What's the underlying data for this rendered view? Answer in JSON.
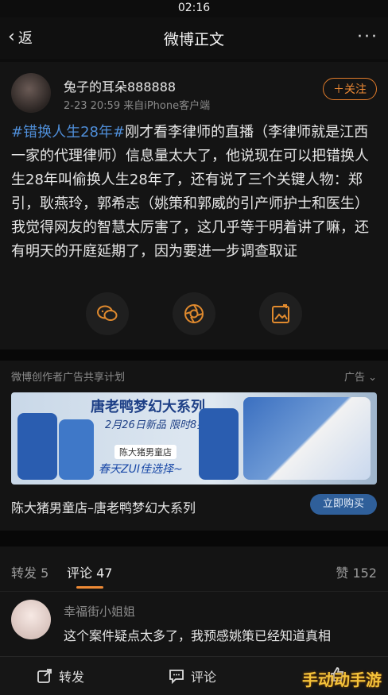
{
  "status_bar": {
    "time": "02:16"
  },
  "nav": {
    "back_label": "返",
    "title": "微博正文",
    "more": "···"
  },
  "post": {
    "username": "兔子的耳朵888888",
    "meta": "2-23 20:59  来自iPhone客户端",
    "follow_label": "＋关注",
    "hashtag": "#错换人生28年#",
    "text": "刚才看李律师的直播（李律师就是江西一家的代理律师）信息量太大了，他说现在可以把错换人生28年叫偷换人生28年了，还有说了三个关键人物：郑引，耿燕玲，郭希志（姚策和郭威的引产师护士和医生）我觉得网友的智慧太厉害了，这几乎等于明着讲了嘛，还有明天的开庭延期了，因为要进一步调查取证"
  },
  "ad": {
    "header": "微博创作者广告共享计划",
    "ad_tag": "广告",
    "banner_title": "唐老鸭梦幻大系列",
    "banner_sub": "2月26日新品 限时8折",
    "banner_shop": "陈大猪男童店",
    "banner_spring": "春天ZUI佳选择~",
    "name": "陈大猪男童店–唐老鸭梦幻大系列",
    "buy_label": "立即购买"
  },
  "tabs": {
    "repost": "转发 5",
    "comment": "评论 47",
    "like": "赞 152"
  },
  "comment": {
    "name": "幸福街小姐姐",
    "text": "这个案件疑点太多了，我预感姚策已经知道真相"
  },
  "bottom_bar": {
    "repost": "转发",
    "comment": "评论"
  },
  "watermark": "手动动手游"
}
